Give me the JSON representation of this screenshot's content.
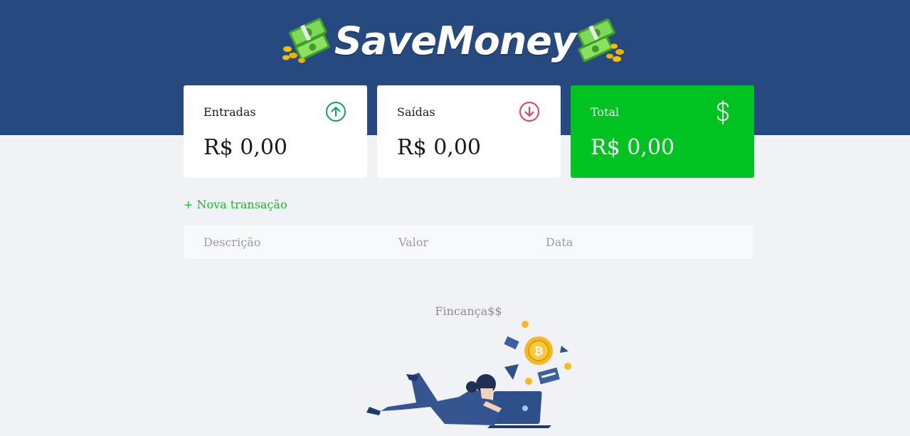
{
  "app": {
    "name": "SaveMoney"
  },
  "summary": [
    {
      "title": "Entradas",
      "value": "R$ 0,00",
      "icon": "arrow-up-circle-icon",
      "color": "#12a454"
    },
    {
      "title": "Saídas",
      "value": "R$ 0,00",
      "icon": "arrow-down-circle-icon",
      "color": "#e83f5b"
    },
    {
      "title": "Total",
      "value": "R$ 0,00",
      "icon": "dollar-icon",
      "color": "#00c221"
    }
  ],
  "actions": {
    "new_transaction": "+ Nova transação"
  },
  "table": {
    "columns": [
      "Descrição",
      "Valor",
      "Data"
    ]
  },
  "empty_state": {
    "title": "Fincança$$"
  },
  "colors": {
    "header": "#264a80",
    "background": "#f0f2f5",
    "accent": "#00c221"
  }
}
